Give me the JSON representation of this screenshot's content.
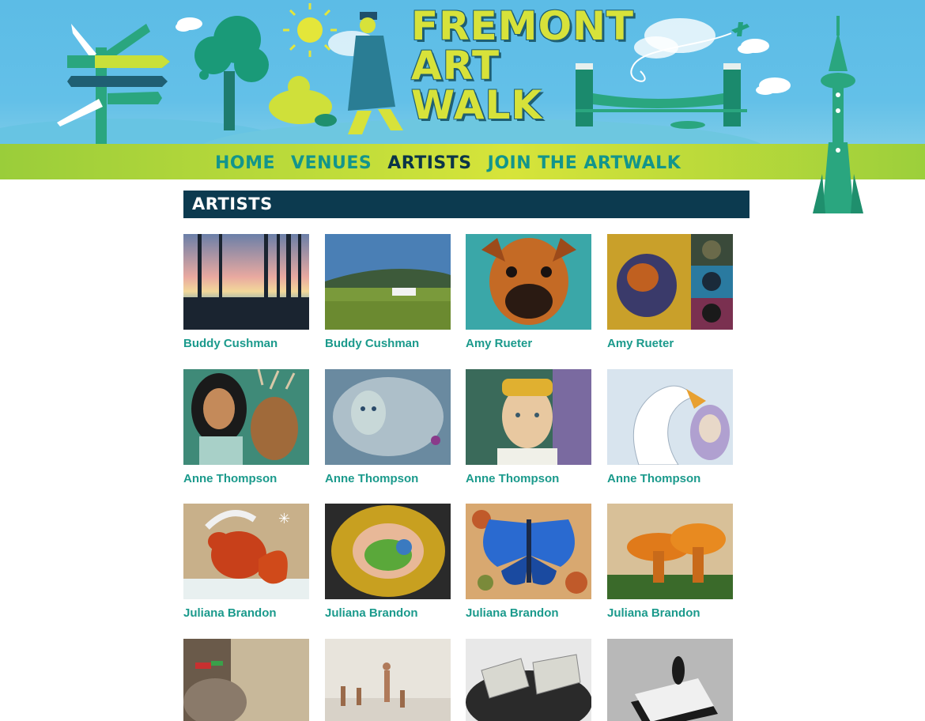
{
  "header": {
    "logo_lines": [
      "FREMONT",
      "ART",
      "WALK"
    ]
  },
  "nav": {
    "items": [
      {
        "label": "HOME",
        "active": false
      },
      {
        "label": "VENUES",
        "active": false
      },
      {
        "label": "ARTISTS",
        "active": true
      },
      {
        "label": "JOIN THE ARTWALK",
        "active": false
      }
    ]
  },
  "page": {
    "title": "ARTISTS"
  },
  "artists": [
    {
      "name": "Buddy Cushman",
      "art": "sunset-trees"
    },
    {
      "name": "Buddy Cushman",
      "art": "farm-landscape"
    },
    {
      "name": "Amy Rueter",
      "art": "dog-portrait"
    },
    {
      "name": "Amy Rueter",
      "art": "dog-collage"
    },
    {
      "name": "Anne Thompson",
      "art": "girl-with-deer"
    },
    {
      "name": "Anne Thompson",
      "art": "silver-face"
    },
    {
      "name": "Anne Thompson",
      "art": "girl-yellow-hat"
    },
    {
      "name": "Anne Thompson",
      "art": "swan-girl"
    },
    {
      "name": "Juliana Brandon",
      "art": "red-squirrel"
    },
    {
      "name": "Juliana Brandon",
      "art": "bird-on-doily"
    },
    {
      "name": "Juliana Brandon",
      "art": "blue-moth"
    },
    {
      "name": "Juliana Brandon",
      "art": "orange-mushroom"
    },
    {
      "name": "",
      "art": "rocky-shore"
    },
    {
      "name": "",
      "art": "beach-people"
    },
    {
      "name": "",
      "art": "glass-sculpture"
    },
    {
      "name": "",
      "art": "white-sculpture"
    }
  ],
  "colors": {
    "sky": "#5cbce6",
    "nav_bar_green": "#c9e03a",
    "nav_link": "#12958c",
    "nav_active": "#0a3448",
    "title_bar": "#0c3a4f",
    "artist_link": "#1b9a8c",
    "logo_yellow": "#d7e23a"
  }
}
